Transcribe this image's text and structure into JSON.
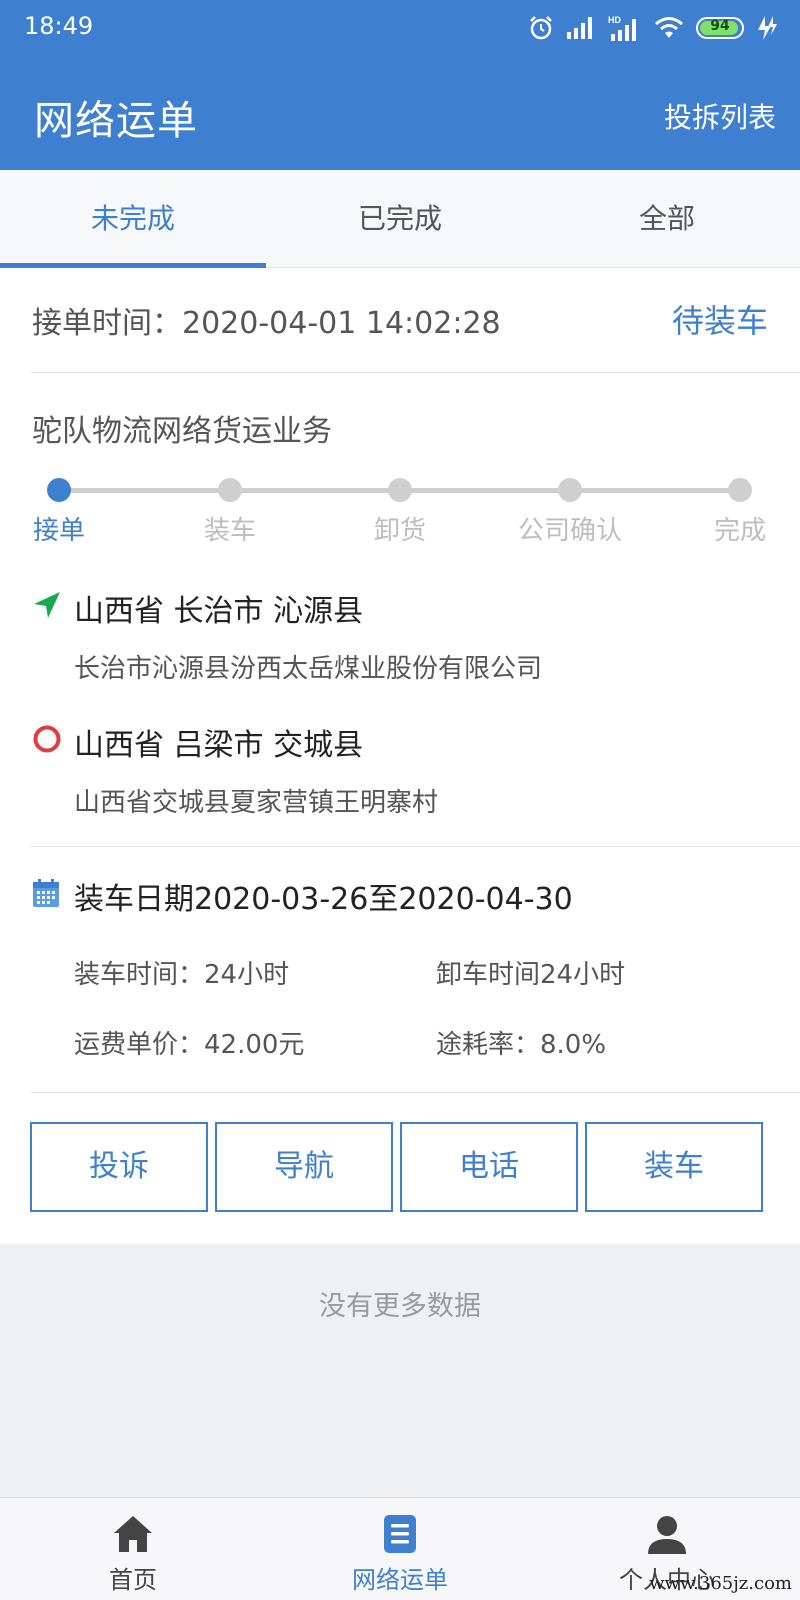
{
  "status_bar": {
    "time": "18:49",
    "battery": "94",
    "network": "HD"
  },
  "appbar": {
    "title": "网络运单",
    "action": "投拆列表"
  },
  "tabs": [
    {
      "label": "未完成",
      "active": true
    },
    {
      "label": "已完成",
      "active": false
    },
    {
      "label": "全部",
      "active": false
    }
  ],
  "order": {
    "accept_time": "接单时间：2020-04-01 14:02:28",
    "status": "待装车",
    "business": "驼队物流网络货运业务",
    "steps": [
      {
        "label": "接单",
        "active": true
      },
      {
        "label": "装车",
        "active": false
      },
      {
        "label": "卸货",
        "active": false
      },
      {
        "label": "公司确认",
        "active": false
      },
      {
        "label": "完成",
        "active": false
      }
    ],
    "origin": {
      "region": "山西省 长治市 沁源县",
      "detail": "长治市沁源县汾西太岳煤业股份有限公司"
    },
    "destination": {
      "region": "山西省 吕梁市 交城县",
      "detail": "山西省交城县夏家营镇王明寨村"
    },
    "load_date": "装车日期2020-03-26至2020-04-30",
    "load_time": "装车时间：24小时",
    "unload_time": "卸车时间24小时",
    "freight_price": "运费单价：42.00元",
    "loss_rate": "途耗率：8.0%",
    "buttons": [
      "投诉",
      "导航",
      "电话",
      "装车"
    ]
  },
  "no_more": "没有更多数据",
  "bottom_nav": [
    {
      "label": "首页",
      "icon": "home-icon",
      "active": false
    },
    {
      "label": "网络运单",
      "icon": "document-list-icon",
      "active": true
    },
    {
      "label": "个人中心",
      "icon": "user-icon",
      "active": false
    }
  ],
  "watermark": "www.365jz.com",
  "colors": {
    "primary": "#3f7fd0",
    "origin_green": "#1aa84a",
    "dest_red": "#e23b3b"
  }
}
